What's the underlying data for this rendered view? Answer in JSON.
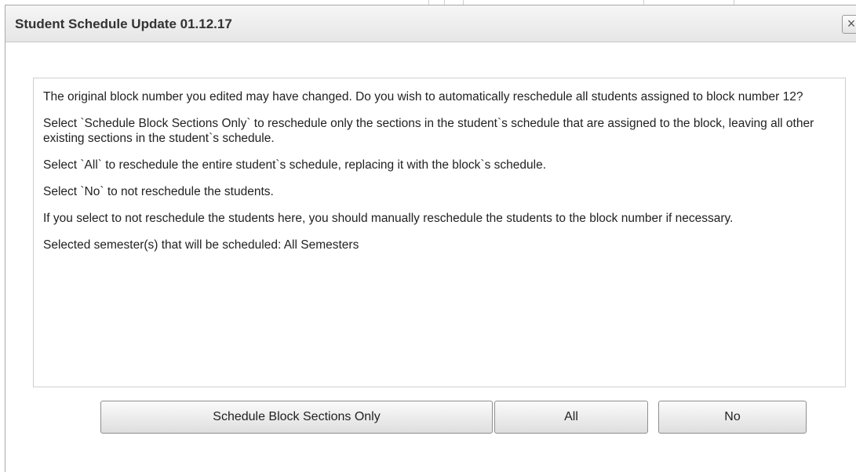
{
  "dialog": {
    "title": "Student Schedule Update 01.12.17",
    "close_glyph": "×",
    "close_icon": "close-icon"
  },
  "message": {
    "paragraphs": [
      "The original block number you edited may have changed.  Do you wish to automatically reschedule all students assigned to block number 12?",
      "Select `Schedule Block Sections Only` to reschedule only the sections in the student`s schedule that are assigned to the block, leaving all other existing sections in the student`s schedule.",
      "Select `All` to reschedule the entire student`s schedule, replacing it with the block`s schedule.",
      "Select `No` to not reschedule the students.",
      "If you select to not reschedule the students here, you should manually reschedule the students to the block number if necessary.",
      "Selected semester(s) that will be scheduled: All Semesters"
    ]
  },
  "buttons": {
    "schedule_block_sections_only": "Schedule Block Sections Only",
    "all": "All",
    "no": "No"
  }
}
